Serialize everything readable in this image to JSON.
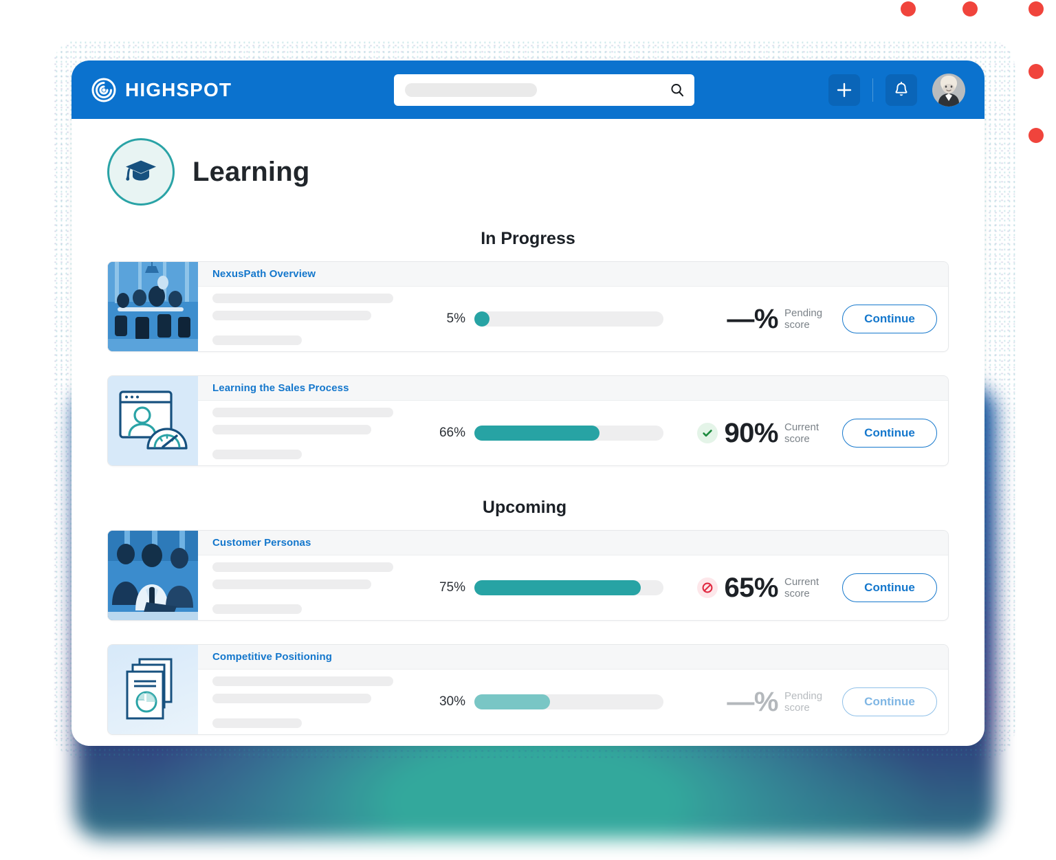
{
  "brand": {
    "name": "HIGHSPOT",
    "logo_icon": "highspot-spiral-logo",
    "header_color": "#0b72ce",
    "accent_blue": "#1477cc",
    "accent_teal": "#27a3a4"
  },
  "header": {
    "search": {
      "placeholder": "",
      "value": "",
      "icon": "search-icon"
    },
    "add_button": {
      "icon": "plus-icon",
      "label": "+"
    },
    "notifications_button": {
      "icon": "bell-icon"
    },
    "avatar": {
      "icon": "user-avatar"
    }
  },
  "page": {
    "title": "Learning",
    "title_icon": "graduation-cap-icon"
  },
  "sections": [
    {
      "heading": "In Progress",
      "courses": [
        {
          "name": "NexusPath Overview",
          "thumbnail": "meeting-room-photo",
          "progress_label": "5%",
          "progress_value": 5,
          "score_value": "—%",
          "score_label": "Pending score",
          "score_status": "pending",
          "status_icon": "none",
          "button_label": "Continue",
          "muted": false
        },
        {
          "name": "Learning the Sales Process",
          "thumbnail": "browser-person-gauge-icon",
          "progress_label": "66%",
          "progress_value": 66,
          "score_value": "90%",
          "score_label": "Current score",
          "score_status": "pass",
          "status_icon": "check-circle-icon",
          "button_label": "Continue",
          "muted": false
        }
      ]
    },
    {
      "heading": "Upcoming",
      "courses": [
        {
          "name": "Customer Personas",
          "thumbnail": "business-meeting-photo",
          "progress_label": "75%",
          "progress_value": 75,
          "score_value": "65%",
          "score_label": "Current score",
          "score_status": "fail",
          "status_icon": "blocked-circle-icon",
          "button_label": "Continue",
          "muted": false
        },
        {
          "name": "Competitive Positioning",
          "thumbnail": "documents-pie-chart-icon",
          "progress_label": "30%",
          "progress_value": 30,
          "score_value": "—%",
          "score_label": "Pending score",
          "score_status": "pending",
          "status_icon": "none",
          "button_label": "Continue",
          "muted": true
        }
      ]
    }
  ],
  "decor": {
    "dot_color": "#f0443c",
    "dot_count": 6
  }
}
